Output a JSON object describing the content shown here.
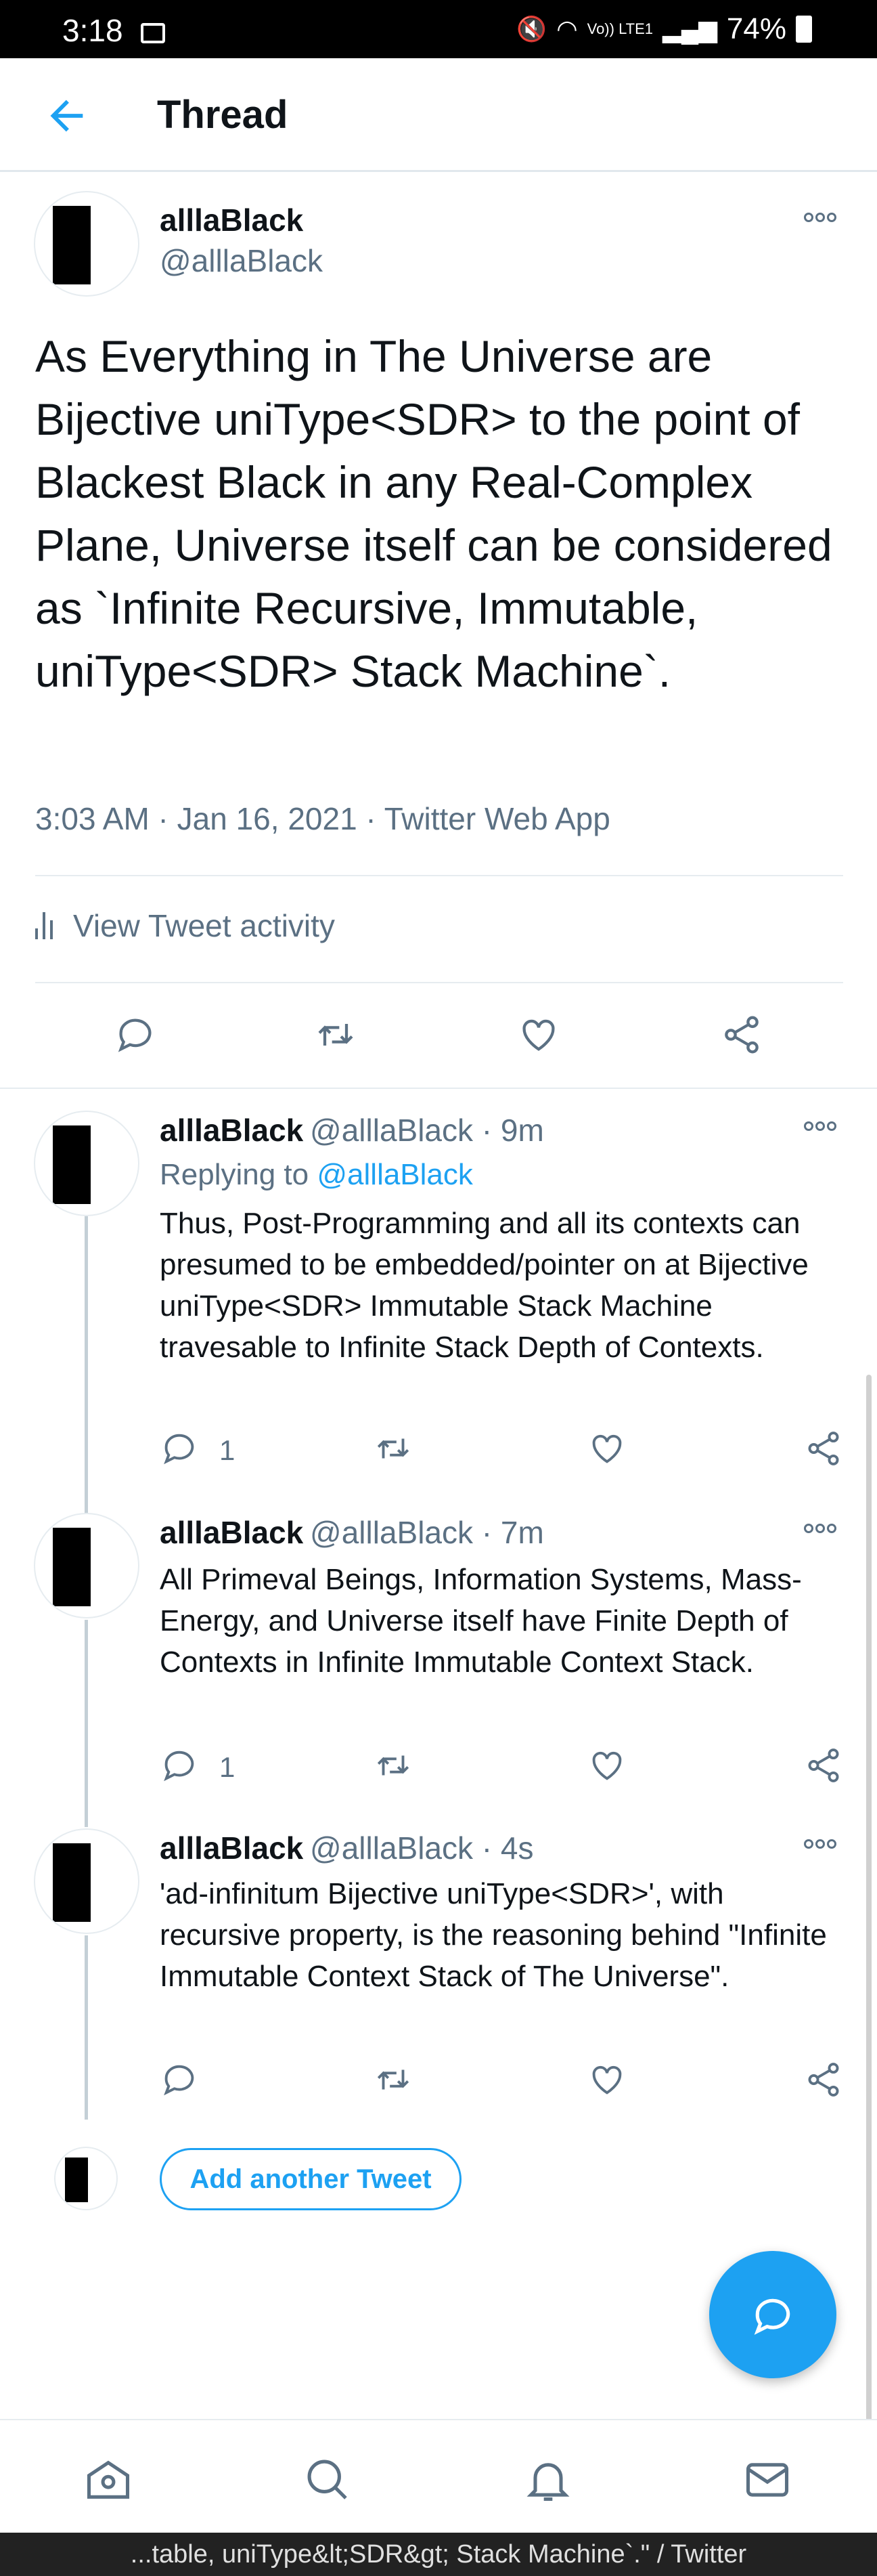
{
  "status_bar": {
    "time": "3:18",
    "network": "Vo)) LTE1",
    "battery": "74%"
  },
  "header": {
    "title": "Thread"
  },
  "main_tweet": {
    "display_name": "alllaBlack",
    "handle": "@alllaBlack",
    "text": "As Everything in The Universe are Bijective uniType<SDR> to the point of Blackest Black in any Real-Complex Plane, Universe itself can be considered as `Infinite Recursive, Immutable, uniType<SDR> Stack Machine`.",
    "meta": "3:03 AM · Jan 16, 2021 · Twitter Web App",
    "activity_label": "View Tweet activity"
  },
  "replies": [
    {
      "display_name": "alllaBlack",
      "handle_time": "@alllaBlack · 9m",
      "replying_prefix": "Replying to",
      "replying_to": "@alllaBlack",
      "text": "Thus, Post-Programming and all its contexts can presumed to be embedded/pointer on at Bijective uniType<SDR> Immutable Stack Machine travesable to Infinite Stack Depth of Contexts.",
      "reply_count": "1"
    },
    {
      "display_name": "alllaBlack",
      "handle_time": "@alllaBlack · 7m",
      "text": "All Primeval Beings, Information Systems, Mass-Energy, and Universe itself have Finite Depth of Contexts in Infinite Immutable Context Stack.",
      "reply_count": "1"
    },
    {
      "display_name": "alllaBlack",
      "handle_time": "@alllaBlack · 4s",
      "text": "'ad-infinitum Bijective uniType<SDR>', with recursive property, is the reasoning behind \"Infinite Immutable Context Stack of The Universe\".",
      "reply_count": ""
    }
  ],
  "add_tweet_label": "Add another Tweet",
  "page_caption": "...table, uniType&lt;SDR&gt; Stack Machine`.\" / Twitter",
  "colors": {
    "accent": "#1da1f2",
    "secondary_text": "#5b7083"
  },
  "icons": [
    "back-arrow-icon",
    "more-icon",
    "reply-icon",
    "retweet-icon",
    "like-icon",
    "share-icon",
    "compose-icon",
    "home-icon",
    "search-icon",
    "notifications-icon",
    "messages-icon"
  ]
}
